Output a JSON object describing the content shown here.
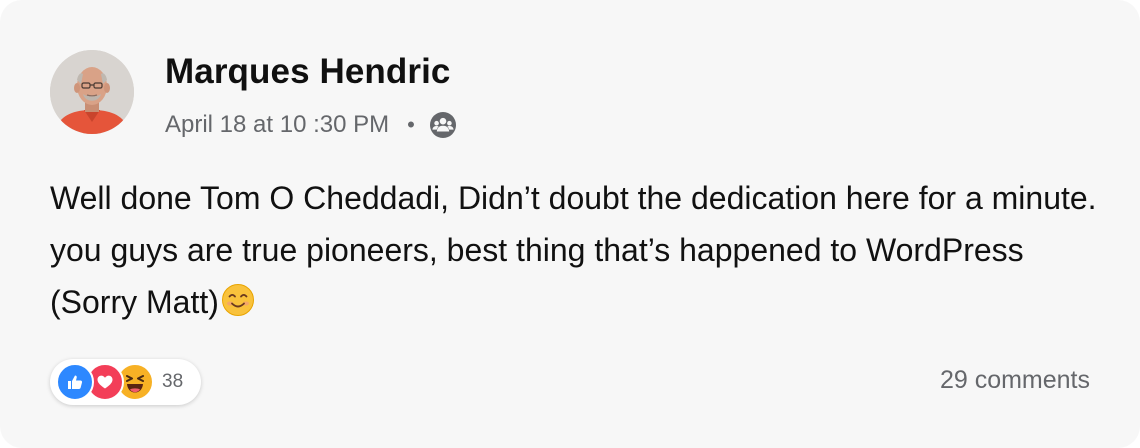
{
  "post": {
    "author": "Marques Hendric",
    "timestamp": "April 18 at 10 :30 PM",
    "separator": "•",
    "audience_icon": "group-icon",
    "text": "Well done Tom O Cheddadi, Didn’t doubt the dedication here for a minute. you guys are true pioneers, best thing that’s happened to WordPress (Sorry Matt)",
    "trailing_emoji": "smiling-face-emoji"
  },
  "reactions": {
    "types": [
      "like-icon",
      "love-icon",
      "haha-icon"
    ],
    "count": "38"
  },
  "comments": {
    "label": "29 comments"
  },
  "colors": {
    "background": "#f7f7f7",
    "secondary_text": "#65676b",
    "like": "#2d88ff",
    "love": "#f33e58",
    "haha": "#f7b125"
  }
}
